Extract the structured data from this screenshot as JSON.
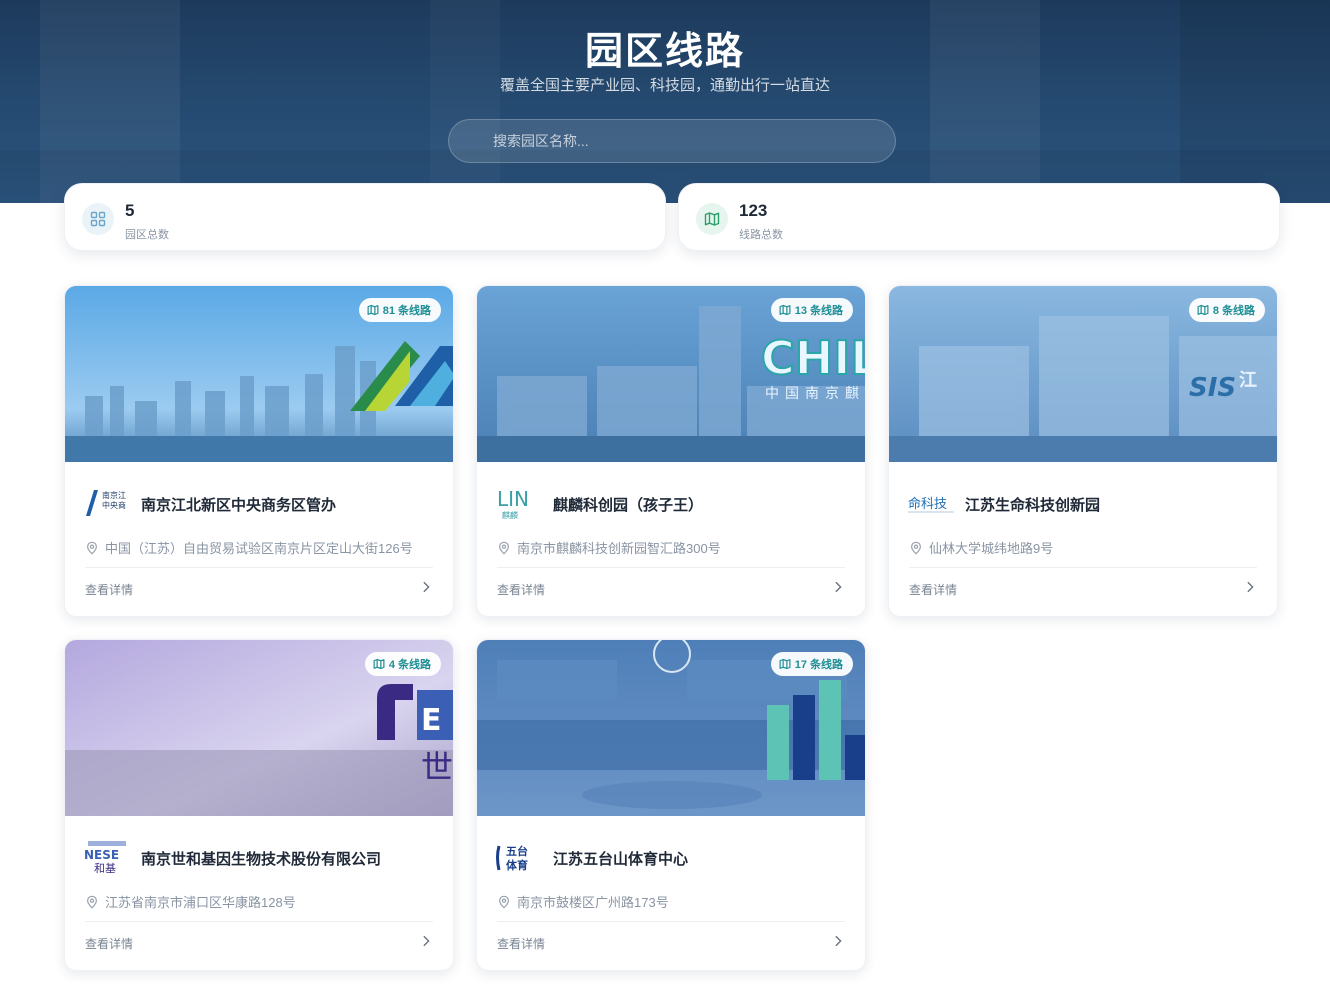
{
  "hero": {
    "title": "园区线路",
    "subtitle": "覆盖全国主要产业园、科技园，通勤出行一站直达",
    "search_placeholder": "搜索园区名称..."
  },
  "stats": [
    {
      "value": "5",
      "label": "园区总数",
      "icon": "grid-icon",
      "color": "#6aa6c9"
    },
    {
      "value": "123",
      "label": "线路总数",
      "icon": "map-icon",
      "color": "#2e9e6b"
    }
  ],
  "cards": [
    {
      "routes": "81 条线路",
      "name": "南京江北新区中央商务区管办",
      "address": "中国（江苏）自由贸易试验区南京片区定山大街126号",
      "details": "查看详情",
      "logo_text": "南京江北中央商务"
    },
    {
      "routes": "13 条线路",
      "name": "麒麟科创园（孩子王）",
      "address": "南京市麒麟科技创新园智汇路300号",
      "details": "查看详情",
      "logo_text": "LIN"
    },
    {
      "routes": "8 条线路",
      "name": "江苏生命科技创新园",
      "address": "仙林大学城纬地路9号",
      "details": "查看详情",
      "logo_text": "命科技"
    },
    {
      "routes": "4 条线路",
      "name": "南京世和基因生物技术股份有限公司",
      "address": "江苏省南京市浦口区华康路128号",
      "details": "查看详情",
      "logo_text": "NESE"
    },
    {
      "routes": "17 条线路",
      "name": "江苏五台山体育中心",
      "address": "南京市鼓楼区广州路173号",
      "details": "查看详情",
      "logo_text": "五台体育"
    }
  ],
  "colors": {
    "accent": "#1f8f96",
    "hero_bg": "#24486e",
    "text_muted": "#8a94a3"
  }
}
